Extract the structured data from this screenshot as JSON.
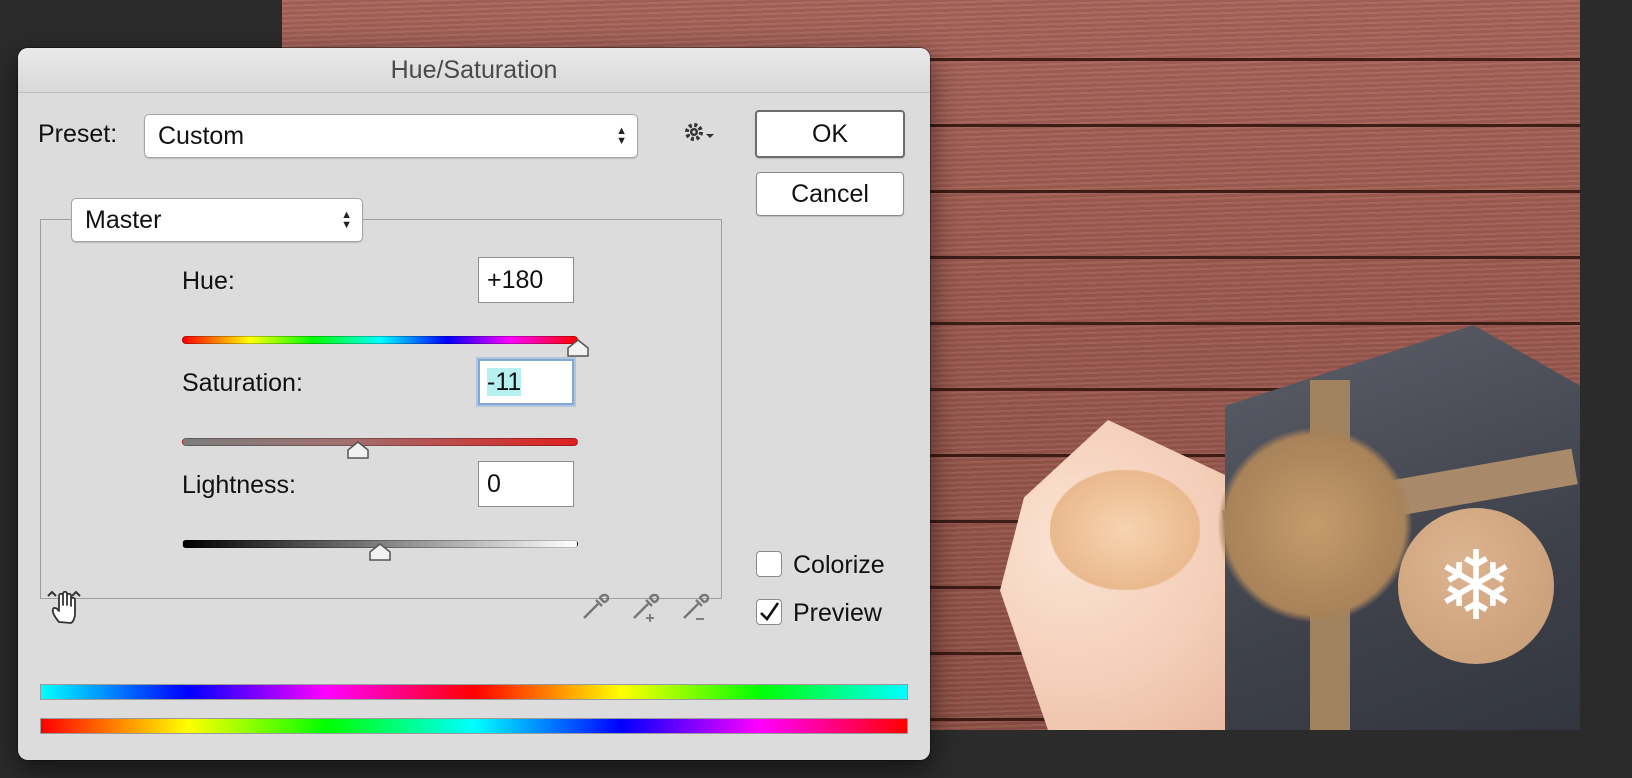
{
  "dialog": {
    "title": "Hue/Saturation",
    "preset_label": "Preset:",
    "preset_value": "Custom",
    "channel_value": "Master",
    "ok_label": "OK",
    "cancel_label": "Cancel",
    "colorize_label": "Colorize",
    "colorize_checked": false,
    "preview_label": "Preview",
    "preview_checked": true
  },
  "adjustments": {
    "hue": {
      "label": "Hue:",
      "value": "+180",
      "range": [
        -180,
        180
      ],
      "level": 180
    },
    "saturation": {
      "label": "Saturation:",
      "value": "-11",
      "range": [
        -100,
        100
      ],
      "level": -11
    },
    "lightness": {
      "label": "Lightness:",
      "value": "0",
      "range": [
        -100,
        100
      ],
      "level": 0
    }
  },
  "icons": {
    "settings": "gear-icon",
    "targeted_adjustment": "hand-icon",
    "eyedroppers": [
      "eyedropper-icon",
      "eyedropper-plus-icon",
      "eyedropper-minus-icon"
    ],
    "snowflake": "❄"
  }
}
